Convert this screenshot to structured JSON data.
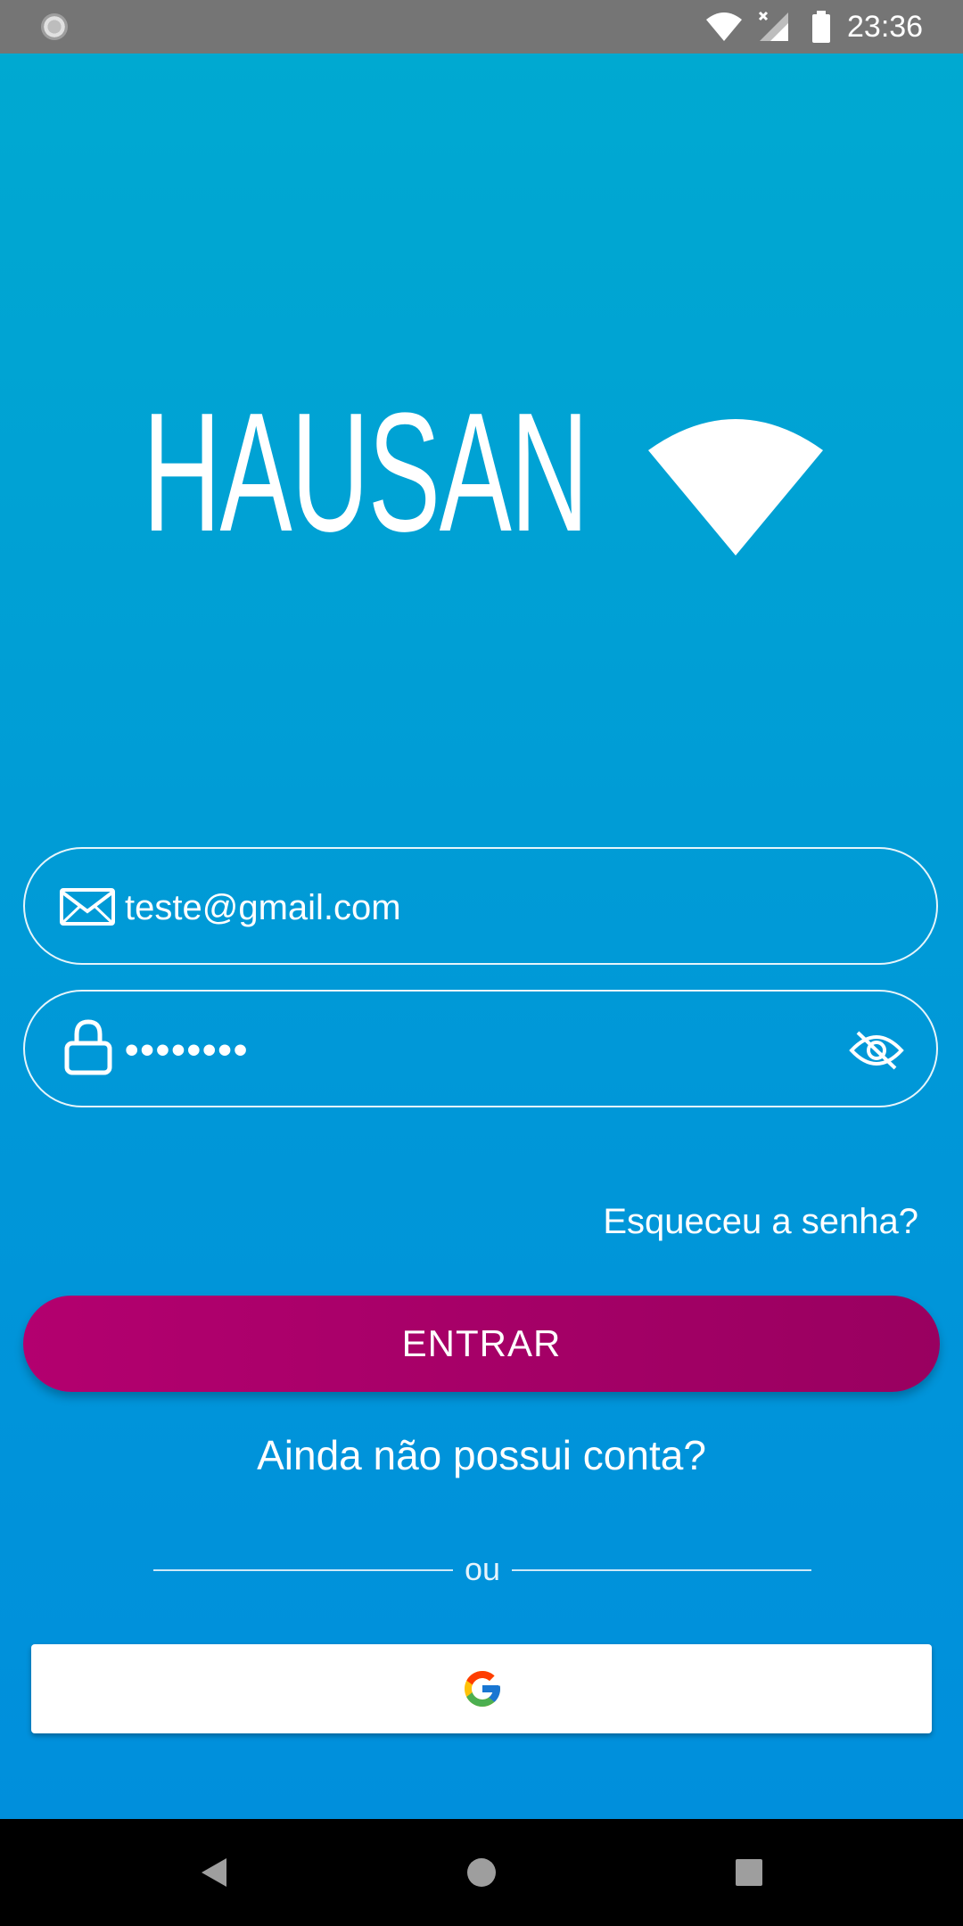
{
  "status_bar": {
    "time": "23:36",
    "icons": [
      "notification-icon",
      "wifi-icon",
      "signal-icon",
      "battery-icon"
    ]
  },
  "logo": {
    "text": "HAUSAN",
    "mark": "wifi-wedge-logo"
  },
  "login_form": {
    "email": {
      "icon": "envelope-icon",
      "value": "teste@gmail.com"
    },
    "password": {
      "icon": "lock-icon",
      "value": "••••••••",
      "toggle_icon": "eye-off-icon"
    },
    "forgot_password": "Esqueceu a senha?",
    "submit_label": "ENTRAR",
    "signup_link": "Ainda não possui conta?",
    "divider_text": "ou",
    "google_button_icon": "google-icon"
  },
  "nav_bar": {
    "buttons": [
      "back-icon",
      "home-icon",
      "recents-icon"
    ]
  },
  "colors": {
    "background_top": "#00a9d1",
    "background_bottom": "#008fdc",
    "primary_button": "#b3006f",
    "status_bar": "#757575",
    "text": "#ffffff"
  }
}
